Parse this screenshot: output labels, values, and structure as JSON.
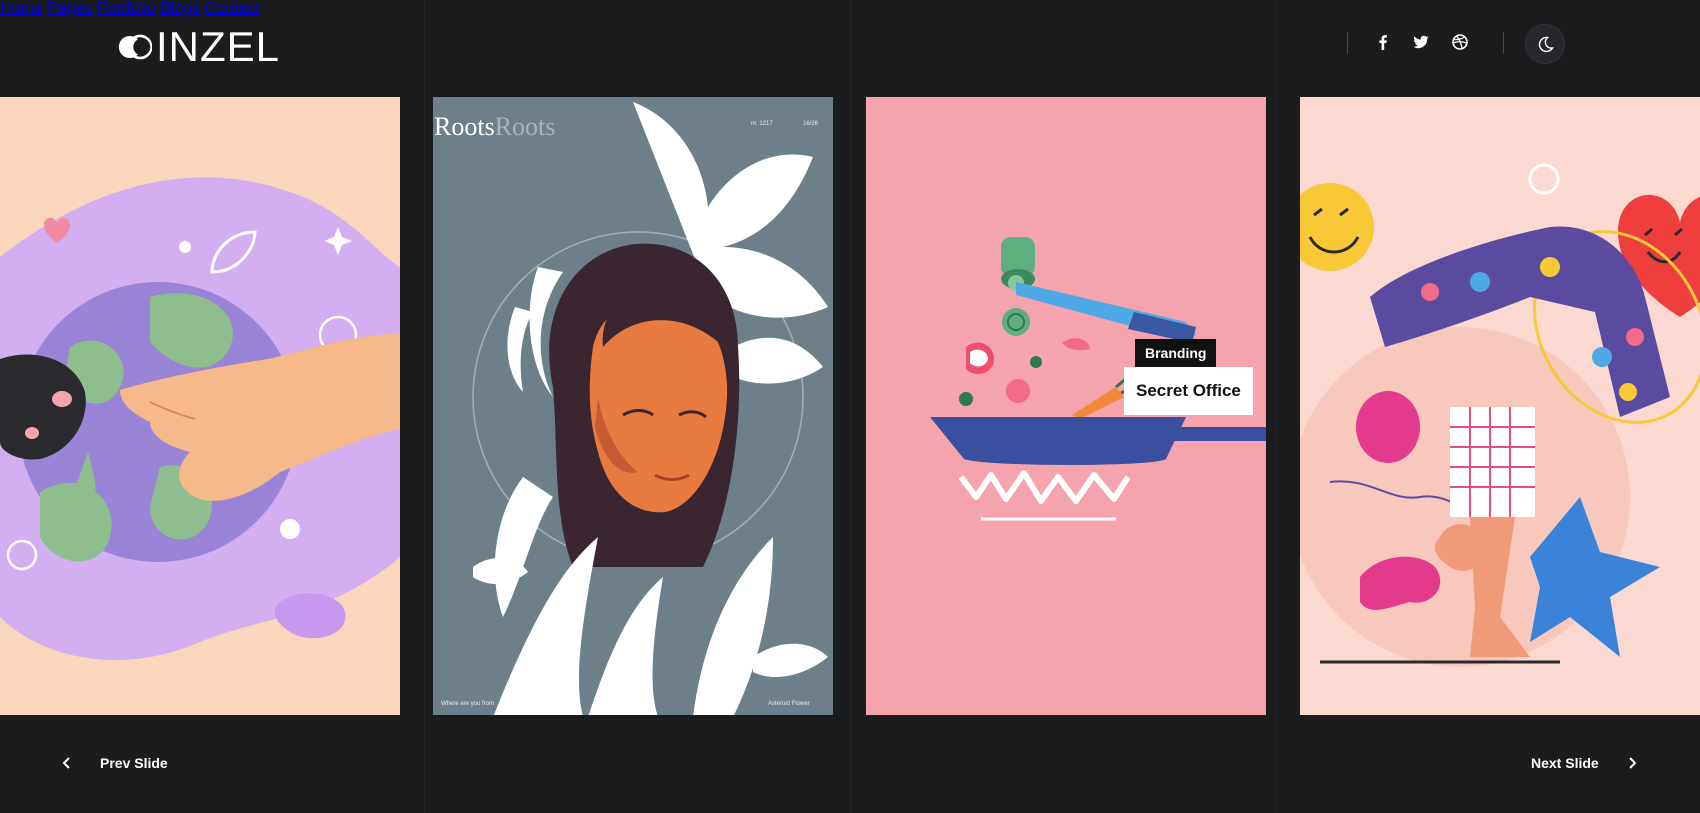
{
  "brand": {
    "logo_text": "INZEL"
  },
  "nav": {
    "items": [
      {
        "label": "Home"
      },
      {
        "label": "Pages"
      },
      {
        "label": "Portfolio"
      },
      {
        "label": "Blogs"
      },
      {
        "label": "Contact"
      }
    ]
  },
  "social": [
    "facebook-icon",
    "twitter-icon",
    "dribbble-icon"
  ],
  "theme_toggle": {
    "icon": "moon-icon"
  },
  "slides": [
    {
      "illustration": "earth-hand-illustration",
      "bg": "#fcd5bd"
    },
    {
      "illustration": "roots-portrait-illustration",
      "bg": "#6d7f89",
      "poster_title": "Roots",
      "poster_title_echo": "Roots"
    },
    {
      "illustration": "cooking-pan-illustration",
      "bg": "#f5a3ad",
      "category": "Branding",
      "title": "Secret Office"
    },
    {
      "illustration": "handstand-heart-illustration",
      "bg": "#fbd9d1"
    }
  ],
  "controls": {
    "prev_label": "Prev Slide",
    "next_label": "Next Slide"
  },
  "colors": {
    "background": "#1b1c1e",
    "text": "#ffffff"
  }
}
